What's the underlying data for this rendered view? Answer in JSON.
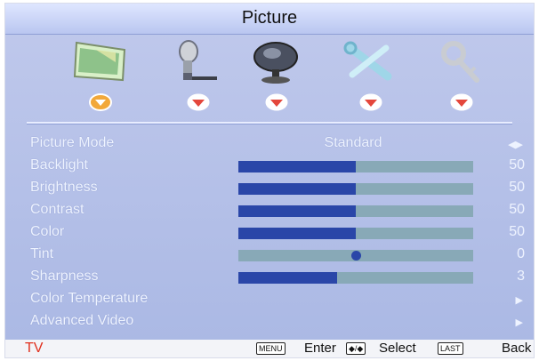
{
  "header": {
    "title": "Picture"
  },
  "menu_icons": [
    "picture-icon",
    "audio-icon",
    "channel-icon",
    "settings-icon",
    "parental-lock-icon"
  ],
  "rows": [
    {
      "label": "Picture Mode",
      "value": "Standard",
      "type": "select"
    },
    {
      "label": "Backlight",
      "value": "50",
      "type": "slider",
      "level": 0.5
    },
    {
      "label": "Brightness",
      "value": "50",
      "type": "slider",
      "level": 0.5
    },
    {
      "label": "Contrast",
      "value": "50",
      "type": "slider",
      "level": 0.5
    },
    {
      "label": "Color",
      "value": "50",
      "type": "slider",
      "level": 0.5
    },
    {
      "label": "Tint",
      "value": "0",
      "type": "center-slider",
      "level": 0.5
    },
    {
      "label": "Sharpness",
      "value": "3",
      "type": "slider",
      "level": 0.42
    },
    {
      "label": "Color Temperature",
      "type": "submenu"
    },
    {
      "label": "Advanced Video",
      "type": "submenu"
    }
  ],
  "footer": {
    "source": "TV",
    "menu_key": "MENU",
    "enter_label": "Enter",
    "arrows_key": "◆/◆",
    "select_label": "Select",
    "last_key": "LAST",
    "back_label": "Back"
  },
  "colors": {
    "accent": "#2a46a8",
    "track": "#88a9b7",
    "source": "#e0301e"
  }
}
